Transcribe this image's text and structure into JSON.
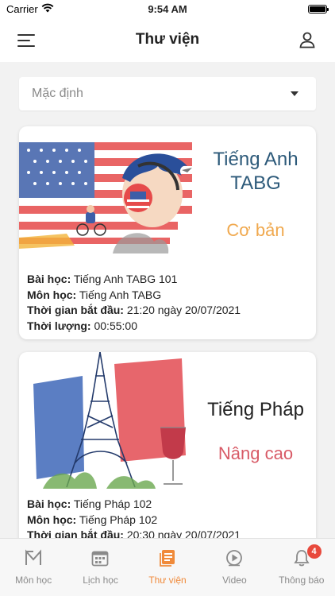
{
  "status_bar": {
    "carrier": "Carrier",
    "time": "9:54 AM"
  },
  "header": {
    "title": "Thư viện"
  },
  "filter": {
    "value": "Mặc định"
  },
  "courses": [
    {
      "name_line1": "Tiếng Anh",
      "name_line2": "TABG",
      "level": "Cơ bản",
      "lesson_label": "Bài học:",
      "lesson": "Tiếng Anh TABG 101",
      "subject_label": "Môn học:",
      "subject": "Tiếng Anh TABG",
      "start_label": "Thời gian bắt đầu:",
      "start": "21:20 ngày 20/07/2021",
      "duration_label": "Thời lượng:",
      "duration": "00:55:00"
    },
    {
      "name_line1": "Tiếng Pháp",
      "level": "Nâng cao",
      "lesson_label": "Bài học:",
      "lesson": "Tiếng Pháp 102",
      "subject_label": "Môn học:",
      "subject": "Tiếng Pháp 102",
      "start_label": "Thời gian bắt đầu:",
      "start": "20:30 ngày 20/07/2021"
    }
  ],
  "tabs": [
    {
      "label": "Môn học",
      "icon": "subject-icon"
    },
    {
      "label": "Lịch học",
      "icon": "calendar-icon"
    },
    {
      "label": "Thư viện",
      "icon": "library-icon",
      "active": true
    },
    {
      "label": "Video",
      "icon": "video-icon"
    },
    {
      "label": "Thông báo",
      "icon": "bell-icon",
      "badge": "4"
    }
  ],
  "colors": {
    "accent": "#f08a3a",
    "badge": "#e8493c",
    "level_basic": "#f0a94f",
    "level_advanced": "#d85a66"
  }
}
